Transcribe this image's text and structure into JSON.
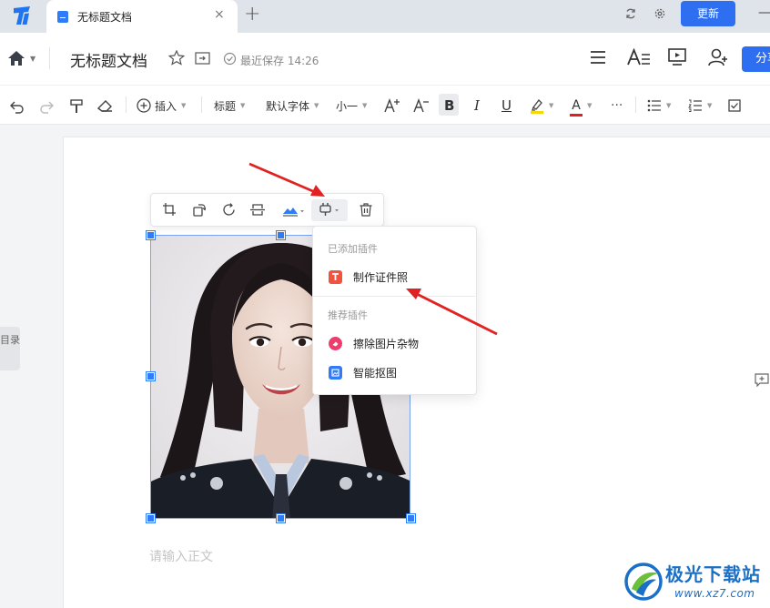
{
  "tab": {
    "title": "无标题文档",
    "close": "×",
    "add": "+"
  },
  "titlebar": {
    "update_label": "更新",
    "minimize": "—"
  },
  "header": {
    "doc_title": "无标题文档",
    "save_status": "最近保存 14:26",
    "share_label": "分享"
  },
  "toolbar": {
    "insert_label": "插入",
    "style_label": "标题",
    "font_label": "默认字体",
    "size_label": "小一",
    "bold": "B",
    "italic": "I",
    "underline": "U",
    "font_color": "A",
    "more": "···",
    "highlight_color": "#f5d90a",
    "font_color_bar": "#e02020"
  },
  "sidebar": {
    "toc_label": "目录"
  },
  "plugin_menu": {
    "added_header": "已添加插件",
    "added_items": [
      {
        "label": "制作证件照",
        "icon": "id-photo-icon",
        "color": "#f0533f"
      }
    ],
    "recommended_header": "推荐插件",
    "recommended_items": [
      {
        "label": "擦除图片杂物",
        "icon": "erase-icon",
        "color": "#ee3c6c"
      },
      {
        "label": "智能抠图",
        "icon": "cutout-icon",
        "color": "#2f7cf6"
      }
    ]
  },
  "editor": {
    "placeholder": "请输入正文"
  },
  "watermark": {
    "main": "极光下载站",
    "sub": "www.xz7.com"
  },
  "colors": {
    "primary": "#2d6ff0",
    "selection": "#2f7cf6",
    "annotation_arrow": "#e02222"
  }
}
